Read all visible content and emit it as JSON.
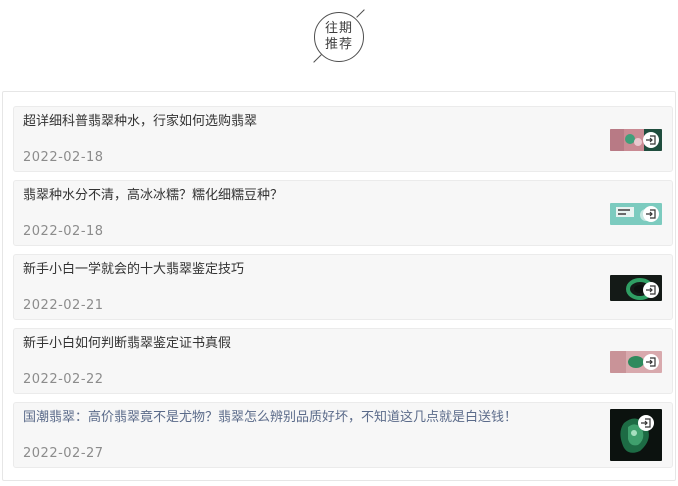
{
  "header": {
    "badge_line1": "往期",
    "badge_line2": "推荐"
  },
  "articles": [
    {
      "title": "超详细科普翡翠种水，行家如何选购翡翠",
      "date": "2022-02-18",
      "thumb_icon": "jump-link-icon"
    },
    {
      "title": "翡翠种水分不清，高冰冰糯？糯化细糯豆种？",
      "date": "2022-02-18",
      "thumb_icon": "jump-link-icon"
    },
    {
      "title": "新手小白一学就会的十大翡翠鉴定技巧",
      "date": "2022-02-21",
      "thumb_icon": "jump-link-icon"
    },
    {
      "title": "新手小白如何判断翡翠鉴定证书真假",
      "date": "2022-02-22",
      "thumb_icon": "jump-link-icon"
    },
    {
      "title": "国潮翡翠：高价翡翠竟不是尤物？翡翠怎么辨别品质好坏，不知道这几点就是白送钱！",
      "date": "2022-02-27",
      "thumb_icon": "jump-link-icon"
    }
  ]
}
